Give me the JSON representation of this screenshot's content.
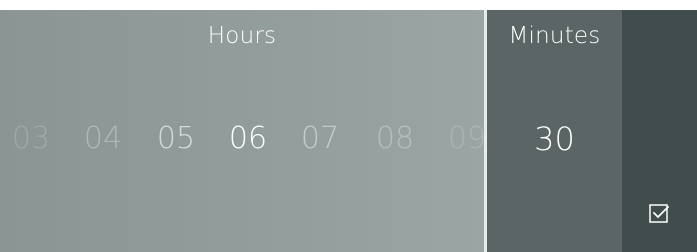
{
  "hours": {
    "title": "Hours",
    "items": [
      {
        "label": "03",
        "opacity": 0.18
      },
      {
        "label": "04",
        "opacity": 0.3
      },
      {
        "label": "05",
        "opacity": 0.62
      },
      {
        "label": "06",
        "opacity": 1.0,
        "selected": true
      },
      {
        "label": "07",
        "opacity": 0.45
      },
      {
        "label": "08",
        "opacity": 0.3
      },
      {
        "label": "09",
        "opacity": 0.18
      }
    ]
  },
  "minutes": {
    "title": "Minutes",
    "value": "30"
  },
  "confirm": {
    "icon": "checkbox-check-icon"
  },
  "colors": {
    "hours_bg": "#939d9c",
    "minutes_bg": "#5b6566",
    "confirm_bg": "#414d4c",
    "text": "#ffffff"
  }
}
